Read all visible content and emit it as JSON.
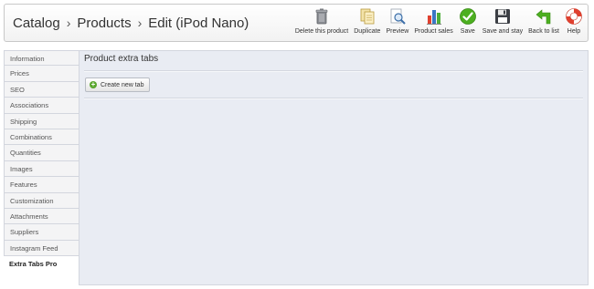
{
  "breadcrumb": {
    "items": [
      "Catalog",
      "Products",
      "Edit (iPod Nano)"
    ],
    "separator": "›"
  },
  "toolbar": {
    "buttons": [
      {
        "label": "Delete this product",
        "icon": "trash-icon"
      },
      {
        "label": "Duplicate",
        "icon": "duplicate-icon"
      },
      {
        "label": "Preview",
        "icon": "magnifier-icon"
      },
      {
        "label": "Product sales",
        "icon": "bar-chart-icon"
      },
      {
        "label": "Save",
        "icon": "checkmark-icon"
      },
      {
        "label": "Save and stay",
        "icon": "floppy-disk-icon"
      },
      {
        "label": "Back to list",
        "icon": "back-arrow-icon"
      },
      {
        "label": "Help",
        "icon": "lifebuoy-icon"
      }
    ]
  },
  "tabs": [
    {
      "label": "Information"
    },
    {
      "label": "Prices"
    },
    {
      "label": "SEO"
    },
    {
      "label": "Associations"
    },
    {
      "label": "Shipping"
    },
    {
      "label": "Combinations"
    },
    {
      "label": "Quantities"
    },
    {
      "label": "Images"
    },
    {
      "label": "Features"
    },
    {
      "label": "Customization"
    },
    {
      "label": "Attachments"
    },
    {
      "label": "Suppliers"
    },
    {
      "label": "Instagram Feed"
    },
    {
      "label": "Extra Tabs Pro",
      "active": true
    }
  ],
  "panel": {
    "title": "Product extra tabs",
    "create_button": "Create new tab"
  },
  "colors": {
    "panel_bg": "#e9ecf3",
    "save_green": "#4caf20",
    "add_green": "#5aa72e"
  }
}
